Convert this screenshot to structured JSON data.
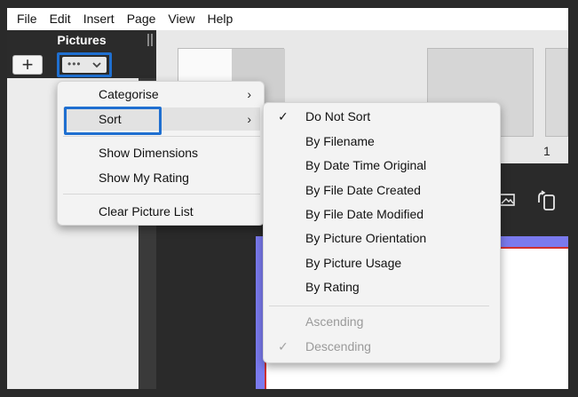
{
  "menubar": {
    "items": [
      "File",
      "Edit",
      "Insert",
      "Page",
      "View",
      "Help"
    ]
  },
  "pictures": {
    "title": "Pictures",
    "add_label": "+",
    "more_label": "•••"
  },
  "workspace": {
    "thumbnail_page_number": "1"
  },
  "menu": {
    "items": [
      {
        "label": "Categorise",
        "has_submenu": true
      },
      {
        "label": "Sort",
        "has_submenu": true
      },
      {
        "label": "Show Dimensions"
      },
      {
        "label": "Show My Rating"
      },
      {
        "label": "Clear Picture List"
      }
    ]
  },
  "sort_menu": {
    "items": [
      {
        "label": "Do Not Sort",
        "checked": true
      },
      {
        "label": "By Filename"
      },
      {
        "label": "By Date Time Original"
      },
      {
        "label": "By File Date Created"
      },
      {
        "label": "By File Date Modified"
      },
      {
        "label": "By Picture Orientation"
      },
      {
        "label": "By Picture Usage"
      },
      {
        "label": "By Rating"
      }
    ],
    "order_items": [
      {
        "label": "Ascending",
        "disabled": true
      },
      {
        "label": "Descending",
        "disabled": true,
        "checked": true
      }
    ]
  },
  "colors": {
    "focus_outline": "#1f6fd0",
    "page_border": "#7a7aee",
    "bleed_line": "#d03030"
  }
}
